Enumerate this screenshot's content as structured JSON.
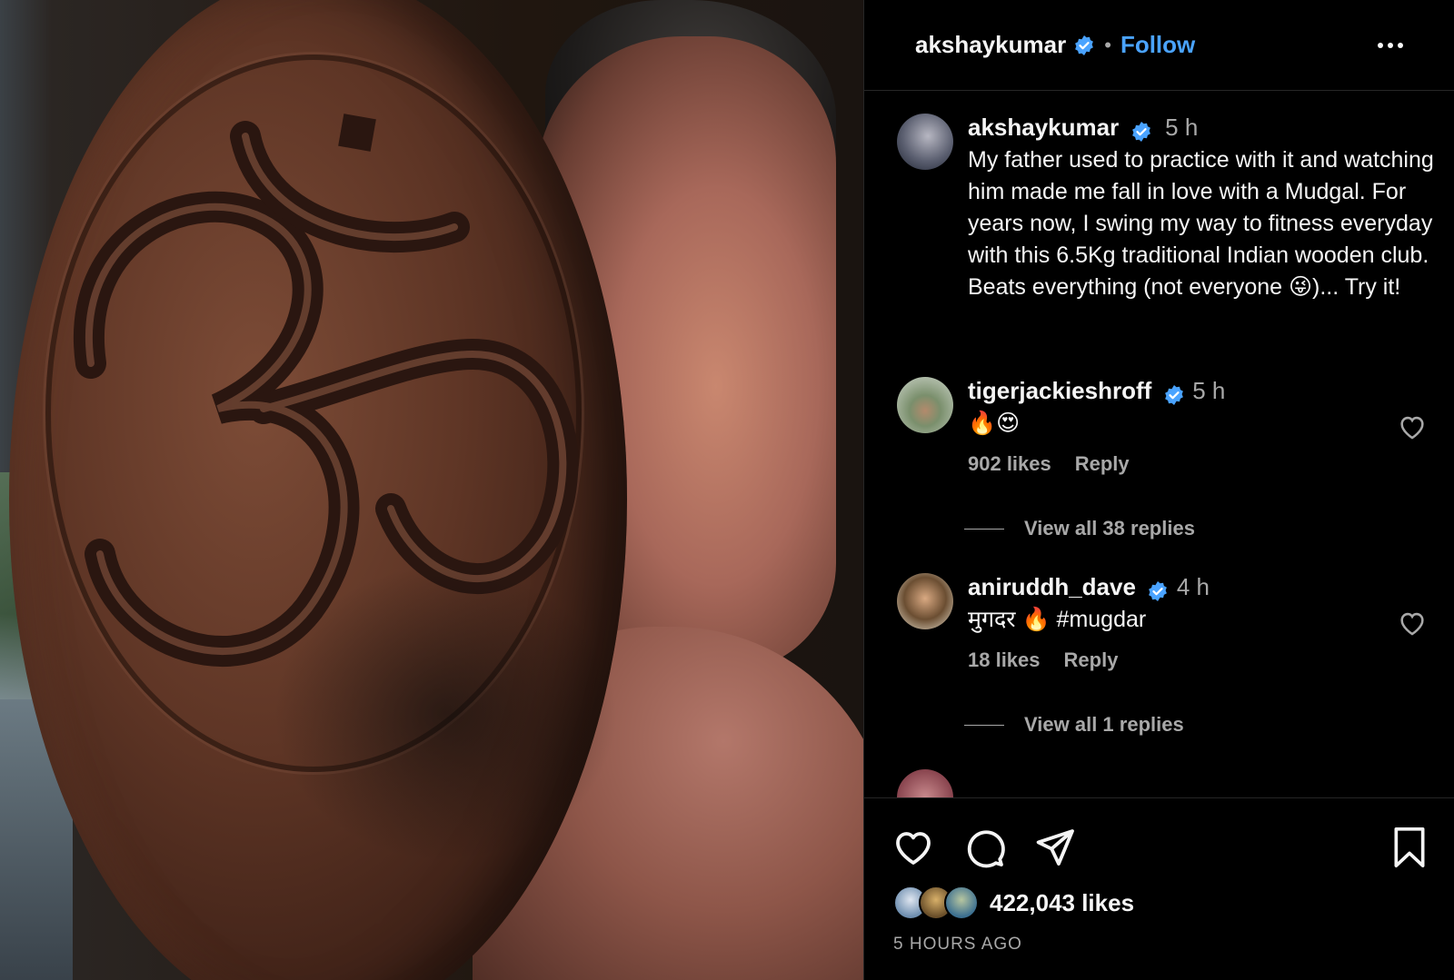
{
  "header": {
    "username": "akshaykumar",
    "dot": "•",
    "follow_label": "Follow"
  },
  "caption": {
    "username": "akshaykumar",
    "time": "5 h",
    "text": "My father used to practice with it and watching him made me fall in love with a Mudgal. For years now, I swing my way to fitness everyday with this 6.5Kg traditional Indian wooden club. Beats everything (not everyone 😜)... Try it!"
  },
  "comments": [
    {
      "username": "tigerjackieshroff",
      "time": "5 h",
      "text": "🔥😍",
      "likes": "902 likes",
      "reply_label": "Reply",
      "view_replies": "View all 38 replies"
    },
    {
      "username": "aniruddh_dave",
      "time": "4 h",
      "text": "मुगदर 🔥 #mugdar",
      "likes": "18 likes",
      "reply_label": "Reply",
      "view_replies": "View all 1 replies"
    }
  ],
  "footer": {
    "likes": "422,043 likes",
    "time_ago": "5 HOURS AGO"
  },
  "colors": {
    "accent": "#4aa3ff",
    "verified": "#4aa3ff",
    "muted": "#a8a8a8",
    "background": "#000000"
  },
  "icons": [
    "verified-badge-icon",
    "more-options-icon",
    "heart-icon",
    "comment-icon",
    "share-icon",
    "bookmark-icon"
  ]
}
